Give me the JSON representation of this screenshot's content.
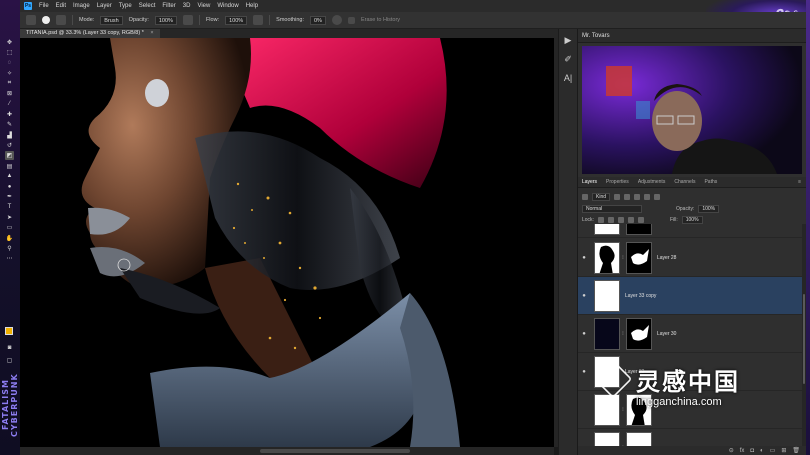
{
  "app": {
    "menu": [
      "File",
      "Edit",
      "Image",
      "Layer",
      "Type",
      "Select",
      "Filter",
      "3D",
      "View",
      "Window",
      "Help"
    ],
    "logo": "Ps"
  },
  "options_bar": {
    "mode_label": "Mode:",
    "mode_value": "Brush",
    "opacity_label": "Opacity:",
    "opacity_value": "100%",
    "flow_label": "Flow:",
    "flow_value": "100%",
    "smoothing_label": "Smoothing:",
    "smoothing_value": "0%",
    "erase_to_history": "Erase to History"
  },
  "document": {
    "tab_title": "TITANIA.psd @ 33.3% (Layer 33 copy, RGB/8) *",
    "close": "×"
  },
  "right_panel": {
    "webcam_title": "Mr. Tovars",
    "tabs": [
      "Layers",
      "Properties",
      "Adjustments",
      "Channels",
      "Paths"
    ],
    "active_tab": "Layers",
    "filter_label": "Kind",
    "blend_mode": "Normal",
    "opacity_label": "Opacity:",
    "opacity_value": "100%",
    "lock_label": "Lock:",
    "fill_label": "Fill:",
    "fill_value": "100%",
    "layers": [
      {
        "name": "",
        "selected": false
      },
      {
        "name": "Layer 28",
        "selected": false
      },
      {
        "name": "Layer 33 copy",
        "selected": true
      },
      {
        "name": "Layer 30",
        "selected": false
      },
      {
        "name": "Layer 32",
        "selected": false
      },
      {
        "name": "",
        "selected": false
      },
      {
        "name": "",
        "selected": false
      }
    ],
    "footer_icons": [
      "link-icon",
      "fx-icon",
      "mask-icon",
      "adjust-icon",
      "folder-icon",
      "new-layer-icon",
      "trash-icon"
    ]
  },
  "branding": {
    "left_strip_text": "FATALISM CYBERPUNK"
  },
  "watermark": {
    "cn_text": "灵感中国",
    "url": "lingganchina.com"
  },
  "colors": {
    "foreground": "#f0b000",
    "background": "#111111",
    "accent": "#31a8ff",
    "selection": "#2a4160"
  }
}
